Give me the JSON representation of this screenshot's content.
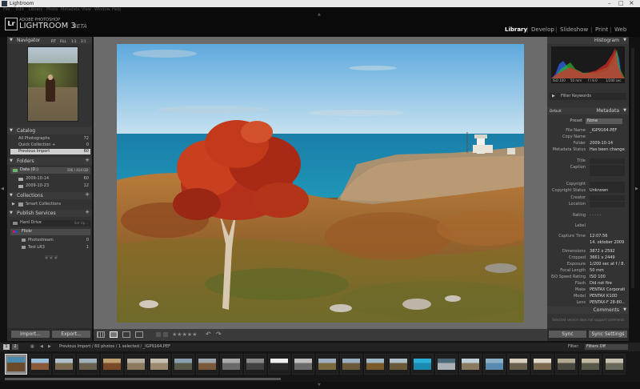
{
  "window": {
    "title": "Lightroom"
  },
  "menu": [
    "File",
    "Edit",
    "Library",
    "Photo",
    "Metadata",
    "View",
    "Window",
    "Help"
  ],
  "app": {
    "logo": "Lr",
    "brand_small": "ADOBE PHOTOSHOP",
    "brand_name": "LIGHTROOM 3",
    "brand_beta": "BETA"
  },
  "modules": [
    {
      "label": "Library",
      "active": true
    },
    {
      "label": "Develop",
      "active": false
    },
    {
      "label": "Slideshow",
      "active": false
    },
    {
      "label": "Print",
      "active": false
    },
    {
      "label": "Web",
      "active": false
    }
  ],
  "navigator": {
    "title": "Navigator",
    "zoom": [
      "FIT",
      "FILL",
      "1:1",
      "3:1"
    ]
  },
  "catalog": {
    "title": "Catalog",
    "items": [
      {
        "label": "All Photographs",
        "count": "72"
      },
      {
        "label": "Quick Collection +",
        "count": "0"
      },
      {
        "label": "Previous Import",
        "count": "60"
      }
    ]
  },
  "folders": {
    "title": "Folders",
    "volume": {
      "label": "Data (D:)",
      "info": "196 / 414 GB"
    },
    "items": [
      {
        "label": "2009-10-14",
        "count": "60"
      },
      {
        "label": "2009-10-23",
        "count": "12"
      }
    ]
  },
  "collections": {
    "title": "Collections",
    "items": [
      {
        "label": "Smart Collections"
      }
    ]
  },
  "publish": {
    "title": "Publish Services",
    "hard_drive": {
      "label": "Hard Drive",
      "action": "Set Up..."
    },
    "flickr": {
      "label": "Flickr",
      "items": [
        {
          "label": "Photostream",
          "count": "0"
        },
        {
          "label": "Test LR3",
          "count": "1"
        }
      ]
    }
  },
  "left_buttons": {
    "import": "Import...",
    "export": "Export..."
  },
  "histogram": {
    "title": "Histogram",
    "info": [
      "ISO 100",
      "50 mm",
      "f / 8.0",
      "1/200 sec"
    ]
  },
  "keywords": {
    "title": "Filter Keywords"
  },
  "metadata": {
    "title": "Metadata",
    "preset_select": "Default",
    "preset": {
      "key": "Preset",
      "value": "None"
    },
    "fields": [
      {
        "key": "File Name",
        "value": "_IGP9164.PEF"
      },
      {
        "key": "Copy Name",
        "value": ""
      },
      {
        "key": "Folder",
        "value": "2009-10-14"
      },
      {
        "key": "Metadata Status",
        "value": "Has been changed"
      },
      {
        "key": "Title",
        "value": ""
      },
      {
        "key": "Caption",
        "value": ""
      },
      {
        "key": "Copyright",
        "value": ""
      },
      {
        "key": "Copyright Status",
        "value": "Unknown"
      },
      {
        "key": "Creator",
        "value": ""
      },
      {
        "key": "Location",
        "value": ""
      },
      {
        "key": "Rating",
        "value": "· · · · ·"
      },
      {
        "key": "Label",
        "value": ""
      },
      {
        "key": "Capture Time",
        "value": "12:07:56"
      },
      {
        "key": "",
        "value": "14. oktober 2009"
      },
      {
        "key": "Dimensions",
        "value": "3872 x 2592"
      },
      {
        "key": "Cropped",
        "value": "3661 x 2449"
      },
      {
        "key": "Exposure",
        "value": "1/200 sec at f / 8.0"
      },
      {
        "key": "Focal Length",
        "value": "50 mm"
      },
      {
        "key": "ISO Speed Rating",
        "value": "ISO 100"
      },
      {
        "key": "Flash",
        "value": "Did not fire"
      },
      {
        "key": "Make",
        "value": "PENTAX Corporation"
      },
      {
        "key": "Model",
        "value": "PENTAX K10D"
      },
      {
        "key": "Lens",
        "value": "PENTAX-F 28-80..."
      }
    ]
  },
  "comments": {
    "title": "Comments",
    "note": "Selected service does not support comments"
  },
  "right_buttons": {
    "sync": "Sync",
    "sync_settings": "Sync Settings"
  },
  "toolbar": {
    "stars": "★★★★★"
  },
  "filmstrip": {
    "pages": [
      "1",
      "2"
    ],
    "source": "Previous Import / 60 photos / 1 selected / _IGP9164.PEF",
    "filter_label": "Filter:",
    "filter_value": "Filters Off"
  },
  "colors": {
    "accent": "#ffffff",
    "panel": "#3a3a3a",
    "sky": "#9ec9e6",
    "sea": "#1f8fb0",
    "tree": "#c23a1a"
  }
}
